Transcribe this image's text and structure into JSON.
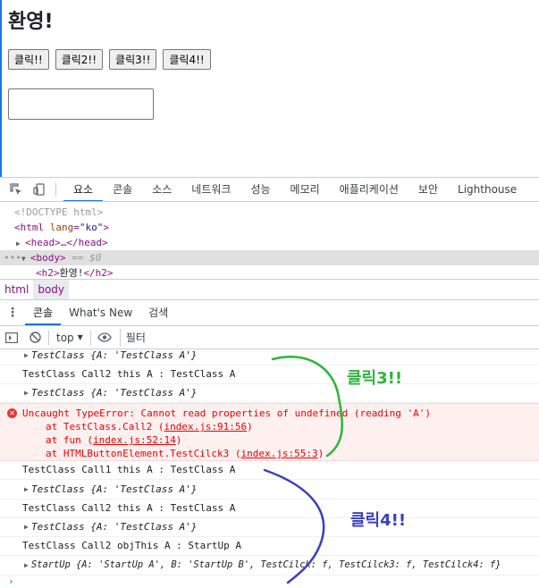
{
  "page": {
    "heading": "환영!",
    "buttons": [
      "클릭!!",
      "클릭2!!",
      "클릭3!!",
      "클릭4!!"
    ]
  },
  "devtools": {
    "tabs": [
      "요소",
      "콘솔",
      "소스",
      "네트워크",
      "성능",
      "메모리",
      "애플리케이션",
      "보안",
      "Lighthouse"
    ],
    "active_tab": "요소",
    "elements": {
      "doctype": "<!DOCTYPE html>",
      "html_open": "<html ",
      "html_attr_name": "lang",
      "html_attr_value": "\"ko\"",
      "html_close": ">",
      "head_collapsed": "<head>…</head>",
      "body_tag": "<body>",
      "body_suffix": " == $0",
      "h2_open": "<h2>",
      "h2_text": "환영!",
      "h2_close": "</h2>"
    },
    "breadcrumbs": [
      "html",
      "body"
    ],
    "drawer_tabs": [
      "콘솔",
      "What's New",
      "검색"
    ],
    "console_toolbar": {
      "context": "top",
      "filter_placeholder": "필터"
    },
    "console_log": {
      "r1": "TestClass {A: 'TestClass A'}",
      "r2": "TestClass Call2 this A : TestClass A",
      "r3": "TestClass {A: 'TestClass A'}",
      "err_msg": "Uncaught TypeError: Cannot read properties of undefined (reading 'A')",
      "err_s1_fn": "at TestClass.Call2 (",
      "err_s1_loc": "index.js:91:56",
      "err_s2_fn": "at fun (",
      "err_s2_loc": "index.js:52:14",
      "err_s3_fn": "at HTMLButtonElement.TestCilck3 (",
      "err_s3_loc": "index.js:55:3",
      "r5": "TestClass Call1 this A : TestClass A",
      "r6": "TestClass {A: 'TestClass A'}",
      "r7": "TestClass Call2 this A : TestClass A",
      "r8": "TestClass {A: 'TestClass A'}",
      "r9": "TestClass Call2 objThis A : StartUp A",
      "r10": "StartUp {A: 'StartUp A', B: 'StartUp B', TestCilck: f, TestCilck3: f, TestCilck4: f}"
    }
  },
  "annotations": {
    "click3_label": "클릭3!!",
    "click4_label": "클릭4!!",
    "click3_color": "#2db53a",
    "click4_color": "#3b3fbf"
  }
}
